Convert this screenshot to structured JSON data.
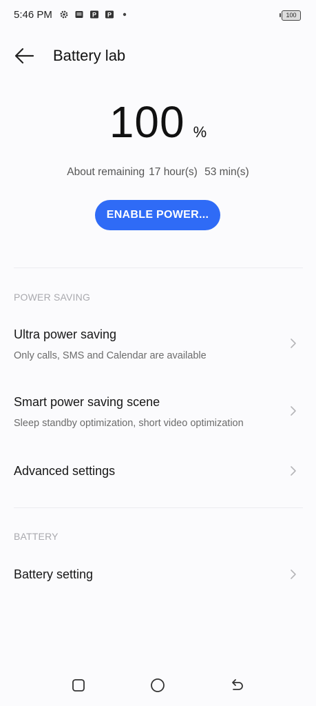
{
  "status_bar": {
    "time": "5:46 PM",
    "icons": [
      "settings-gear-icon",
      "message-icon",
      "p-app-icon",
      "p-app-icon",
      "dot-icon"
    ],
    "battery_level": "100"
  },
  "header": {
    "title": "Battery lab",
    "back_icon": "arrow-left-icon"
  },
  "battery": {
    "percent": "100",
    "unit": "%",
    "remaining_prefix": "About remaining",
    "hours": "17 hour(s)",
    "minutes": "53 min(s)"
  },
  "enable_button": {
    "label": "ENABLE POWER..."
  },
  "sections": {
    "power_saving": {
      "label": "POWER SAVING",
      "items": [
        {
          "title": "Ultra power saving",
          "subtitle": "Only calls, SMS and Calendar are available"
        },
        {
          "title": "Smart power saving scene",
          "subtitle": "Sleep standby optimization, short video optimization"
        },
        {
          "title": "Advanced settings"
        }
      ]
    },
    "battery": {
      "label": "BATTERY",
      "items": [
        {
          "title": "Battery setting"
        }
      ]
    }
  },
  "nav_bar": {
    "icons": [
      "recent-apps-icon",
      "home-icon",
      "back-icon"
    ]
  },
  "colors": {
    "accent": "#2f6bf6",
    "background": "#fbfbfd",
    "section_label": "#a9a9ae"
  }
}
